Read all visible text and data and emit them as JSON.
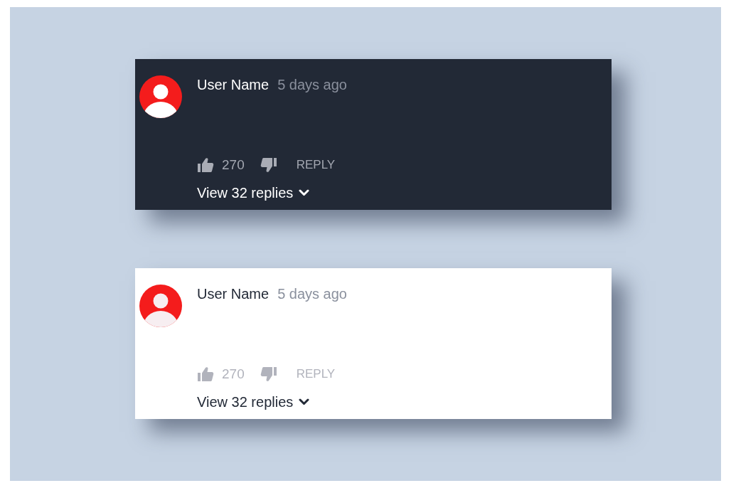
{
  "comments": [
    {
      "kind": "dark",
      "author": "User Name",
      "time": "5 days ago",
      "likes": "270",
      "reply": "REPLY",
      "view_replies": "View 32 replies"
    },
    {
      "kind": "light",
      "author": "User Name",
      "time": "5 days ago",
      "likes": "270",
      "reply": "REPLY",
      "view_replies": "View 32 replies"
    }
  ]
}
